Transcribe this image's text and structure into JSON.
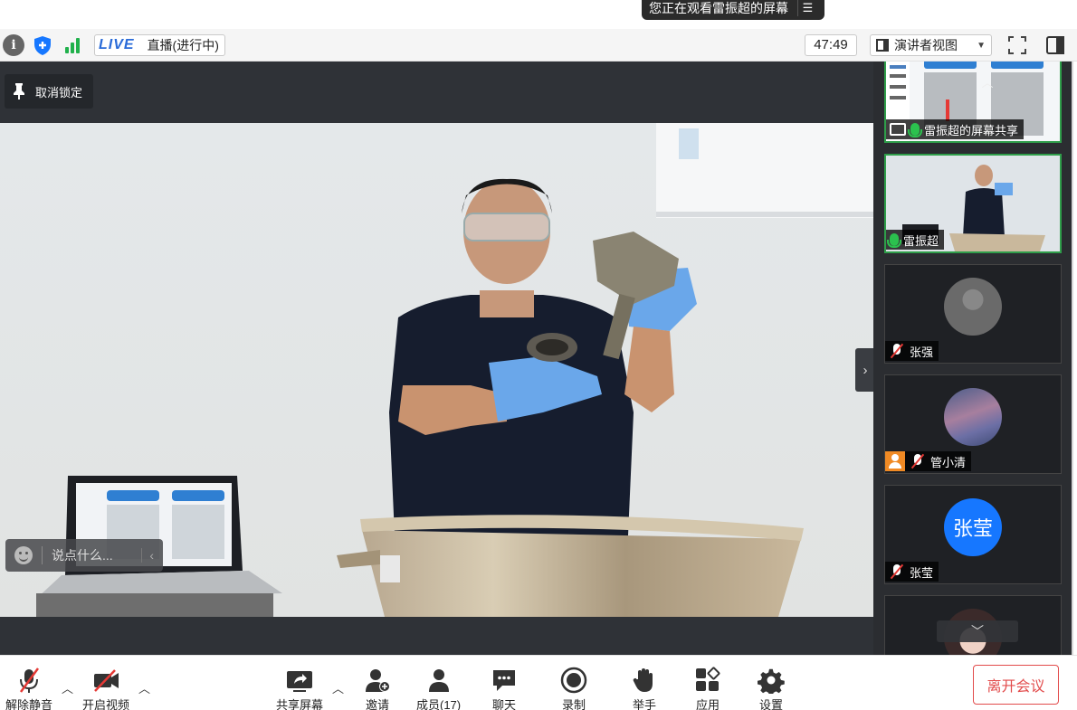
{
  "banner": {
    "viewing_text": "您正在观看雷振超的屏幕",
    "menu_icon": "list-menu-icon"
  },
  "toolbar": {
    "live_tag": "LIVE",
    "live_status": "直播(进行中)",
    "timer": "47:49",
    "view_mode": "演讲者视图"
  },
  "stage": {
    "unlock_label": "取消锁定",
    "chat_placeholder": "说点什么...",
    "collapse_chat": "‹",
    "expand_handle": "›"
  },
  "participants": [
    {
      "name": "雷振超的屏幕共享",
      "mic": "on",
      "type": "screen-share"
    },
    {
      "name": "雷振超",
      "mic": "on",
      "type": "video"
    },
    {
      "name": "张强",
      "mic": "muted",
      "type": "avatar"
    },
    {
      "name": "管小清",
      "mic": "muted",
      "type": "avatar"
    },
    {
      "name": "张莹",
      "avatar_text": "张莹",
      "mic": "muted",
      "type": "avatar"
    },
    {
      "name": "",
      "mic": "muted",
      "type": "avatar"
    }
  ],
  "bottom": {
    "unmute": "解除静音",
    "start_video": "开启视频",
    "share_screen": "共享屏幕",
    "invite": "邀请",
    "members": "成员(17)",
    "chat": "聊天",
    "record": "录制",
    "raise_hand": "举手",
    "apps": "应用",
    "settings": "设置",
    "leave": "离开会议"
  },
  "colors": {
    "accent": "#1677ff",
    "live": "#2a6bd8",
    "active_border": "#2f9e4a",
    "leave": "#e24b4b",
    "mute": "#e53935"
  }
}
